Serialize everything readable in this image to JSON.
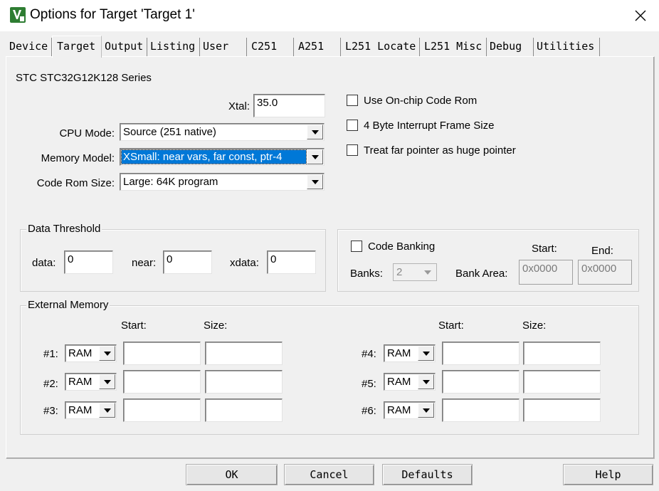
{
  "window": {
    "title": "Options for Target 'Target 1'"
  },
  "tabs": [
    "Device",
    "Target",
    "Output",
    "Listing",
    "User",
    "C251",
    "A251",
    "L251 Locate",
    "L251 Misc",
    "Debug",
    "Utilities"
  ],
  "device": {
    "series": "STC STC32G12K128 Series"
  },
  "target": {
    "xtal_label": "Xtal:",
    "xtal_value": "35.0",
    "cpu_mode_label": "CPU Mode:",
    "cpu_mode_value": "Source (251 native)",
    "memory_model_label": "Memory Model:",
    "memory_model_value": "XSmall: near vars, far const, ptr-4",
    "code_rom_label": "Code Rom Size:",
    "code_rom_value": "Large: 64K program"
  },
  "options": {
    "onchip": "Use On-chip Code Rom",
    "irq_frame": "4 Byte Interrupt Frame Size",
    "far_huge": "Treat far pointer as huge pointer"
  },
  "threshold": {
    "title": "Data Threshold",
    "data_label": "data:",
    "data_value": "0",
    "near_label": "near:",
    "near_value": "0",
    "xdata_label": "xdata:",
    "xdata_value": "0"
  },
  "banking": {
    "label": "Code Banking",
    "banks_label": "Banks:",
    "banks_value": "2",
    "start_label": "Start:",
    "end_label": "End:",
    "area_label": "Bank Area:",
    "start_value": "0x0000",
    "end_value": "0x0000"
  },
  "external": {
    "title": "External Memory",
    "start_header": "Start:",
    "size_header": "Size:",
    "rows": [
      {
        "label": "#1:",
        "type": "RAM"
      },
      {
        "label": "#2:",
        "type": "RAM"
      },
      {
        "label": "#3:",
        "type": "RAM"
      },
      {
        "label": "#4:",
        "type": "RAM"
      },
      {
        "label": "#5:",
        "type": "RAM"
      },
      {
        "label": "#6:",
        "type": "RAM"
      }
    ]
  },
  "buttons": {
    "ok": "OK",
    "cancel": "Cancel",
    "defaults": "Defaults",
    "help": "Help"
  }
}
